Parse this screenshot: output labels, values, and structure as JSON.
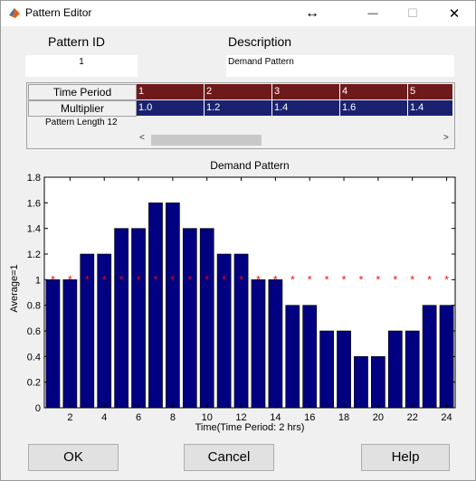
{
  "window": {
    "title": "Pattern Editor",
    "move_glyph": "↔",
    "minimize_glyph": "—",
    "maximize_glyph": "☐",
    "close_glyph": "✕"
  },
  "form": {
    "pattern_id_label": "Pattern ID",
    "description_label": "Description",
    "pattern_id_value": "1",
    "description_value": "Demand Pattern"
  },
  "table": {
    "row_headers": [
      "Time Period",
      "Multiplier"
    ],
    "periods": [
      "1",
      "2",
      "3",
      "4",
      "5"
    ],
    "multipliers": [
      "1.0",
      "1.2",
      "1.4",
      "1.6",
      "1.4"
    ],
    "pattern_length": "Pattern Length 12",
    "scroll_left": "<",
    "scroll_right": ">"
  },
  "chart_data": {
    "type": "bar",
    "title": "Demand Pattern",
    "xlabel": "Time(Time Period: 2 hrs)",
    "ylabel": "Average=1",
    "x": [
      1,
      2,
      3,
      4,
      5,
      6,
      7,
      8,
      9,
      10,
      11,
      12,
      13,
      14,
      15,
      16,
      17,
      18,
      19,
      20,
      21,
      22,
      23,
      24
    ],
    "values": [
      1.0,
      1.0,
      1.2,
      1.2,
      1.4,
      1.4,
      1.6,
      1.6,
      1.4,
      1.4,
      1.2,
      1.2,
      1.0,
      1.0,
      0.8,
      0.8,
      0.6,
      0.6,
      0.4,
      0.4,
      0.6,
      0.6,
      0.8,
      0.8
    ],
    "average": 1,
    "ylim": [
      0,
      1.8
    ],
    "xlim": [
      0.5,
      24.5
    ],
    "yticks": [
      "0",
      "0.2",
      "0.4",
      "0.6",
      "0.8",
      "1",
      "1.2",
      "1.4",
      "1.6",
      "1.8"
    ],
    "xticks": [
      "2",
      "4",
      "6",
      "8",
      "10",
      "12",
      "14",
      "16",
      "18",
      "20",
      "22",
      "24"
    ],
    "bar_color": "#000080",
    "marker_color": "#ff0000"
  },
  "buttons": {
    "ok": "OK",
    "cancel": "Cancel",
    "help": "Help"
  }
}
